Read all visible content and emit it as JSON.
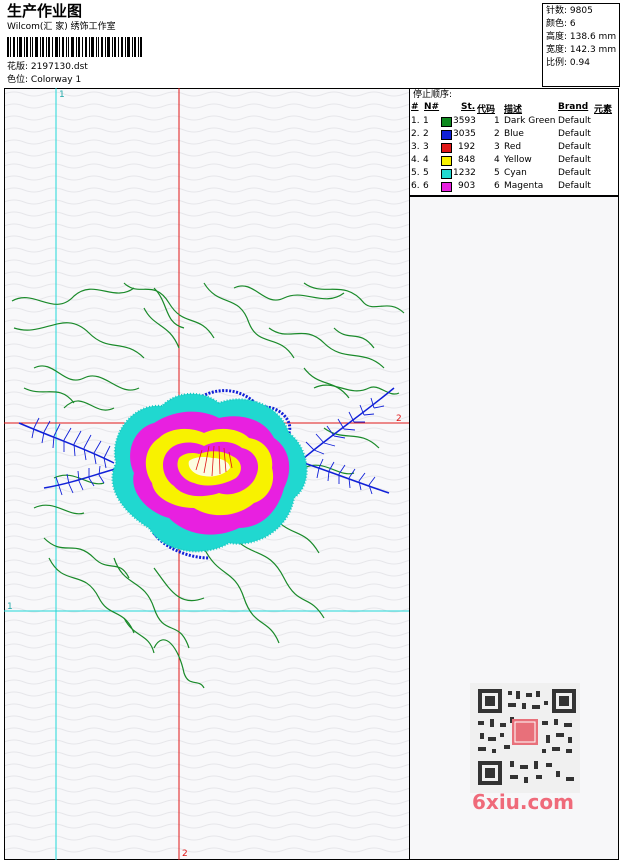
{
  "header": {
    "title": "生产作业图",
    "subtitle": "Wilcom(汇 家) 绣饰工作室",
    "design_label": "花版:",
    "design_value": "2197130.dst",
    "colorway_label": "色位:",
    "colorway_value": "Colorway 1"
  },
  "stats": {
    "stitches_label": "针数:",
    "stitches_value": "9805",
    "colors_label": "颜色:",
    "colors_value": "6",
    "height_label": "高度:",
    "height_value": "138.6 mm",
    "width_label": "宽度:",
    "width_value": "142.3 mm",
    "scale_label": "比例:",
    "scale_value": "0.94"
  },
  "stop_sequence": {
    "title": "停止顺序:",
    "columns": [
      "#",
      "N#",
      "St.",
      "代码",
      "描述",
      "Brand",
      "元素"
    ],
    "rows": [
      {
        "idx": "1.",
        "n": "1",
        "st": "3593",
        "code": "1",
        "desc": "Dark Green",
        "brand": "Default",
        "color": "#0f8a1f"
      },
      {
        "idx": "2.",
        "n": "2",
        "st": "3035",
        "code": "2",
        "desc": "Blue",
        "brand": "Default",
        "color": "#1020d8"
      },
      {
        "idx": "3.",
        "n": "3",
        "st": "192",
        "code": "3",
        "desc": "Red",
        "brand": "Default",
        "color": "#e01818"
      },
      {
        "idx": "4.",
        "n": "4",
        "st": "848",
        "code": "4",
        "desc": "Yellow",
        "brand": "Default",
        "color": "#f8f200"
      },
      {
        "idx": "5.",
        "n": "5",
        "st": "1232",
        "code": "5",
        "desc": "Cyan",
        "brand": "Default",
        "color": "#20d8d0"
      },
      {
        "idx": "6.",
        "n": "6",
        "st": "903",
        "code": "6",
        "desc": "Magenta",
        "brand": "Default",
        "color": "#e820e0"
      }
    ]
  },
  "guides": {
    "marker_1_top": "1",
    "marker_1_left": "1",
    "marker_2_right": "2",
    "marker_2_bottom": "2"
  },
  "watermark": {
    "text": "6xiu.com",
    "color": "#ef6a7a"
  }
}
